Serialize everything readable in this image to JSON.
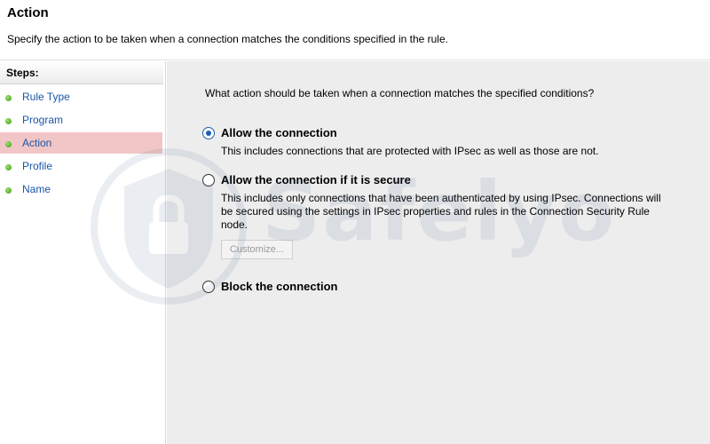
{
  "header": {
    "title": "Action",
    "description": "Specify the action to be taken when a connection matches the conditions specified in the rule."
  },
  "steps": {
    "title": "Steps:",
    "items": [
      {
        "label": "Rule Type",
        "active": false
      },
      {
        "label": "Program",
        "active": false
      },
      {
        "label": "Action",
        "active": true
      },
      {
        "label": "Profile",
        "active": false
      },
      {
        "label": "Name",
        "active": false
      }
    ]
  },
  "main": {
    "question": "What action should be taken when a connection matches the specified conditions?",
    "options": [
      {
        "label": "Allow the connection",
        "description": "This includes connections that are protected with IPsec as well as those are not.",
        "checked": true
      },
      {
        "label": "Allow the connection if it is secure",
        "description": "This includes only connections that have been authenticated by using IPsec.  Connections will be secured using the settings in IPsec properties and rules in the Connection Security Rule node.",
        "checked": false
      },
      {
        "label": "Block the connection",
        "description": "",
        "checked": false
      }
    ],
    "customize_label": "Customize..."
  },
  "watermark": {
    "text": "Safelyo"
  },
  "colors": {
    "accent": "#1a5fb4",
    "step_link": "#1a56a8",
    "active_step_bg": "#f2c6c6",
    "panel_bg": "#ededed"
  }
}
